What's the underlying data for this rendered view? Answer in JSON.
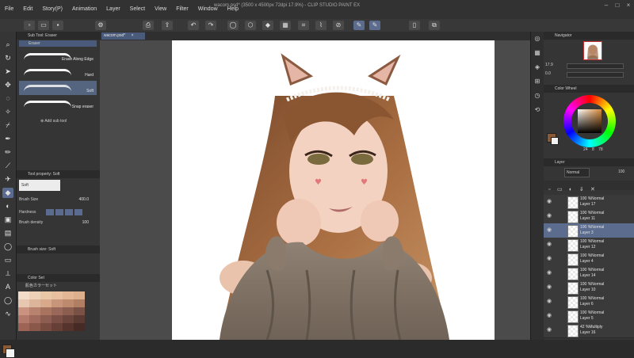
{
  "app": {
    "title": "wacom.psd* (3500 x 4500px 72dpi 17.9%) - CLIP STUDIO PAINT EX",
    "menu": [
      "File",
      "Edit",
      "Story(P)",
      "Animation",
      "Layer",
      "Select",
      "View",
      "Filter",
      "Window",
      "Help"
    ]
  },
  "document_tab": {
    "label": "wacom.psd*",
    "close": "×"
  },
  "left": {
    "subtool_header": "Sub Tool: Eraser",
    "subtool_group": "Eraser",
    "brushes": [
      {
        "label": "Erase Along Edge"
      },
      {
        "label": "Hard"
      },
      {
        "label": "Soft"
      },
      {
        "label": "Snap eraser"
      }
    ],
    "add_subtool": "Add sub tool",
    "toolprop_header": "Tool property: Soft",
    "toolprop_name": "Soft",
    "brush_size_label": "Brush Size",
    "brush_size_value": "400.0",
    "hardness_label": "Hardness",
    "density_label": "Brush density",
    "density_value": "100",
    "brushsize_header": "Brush size: Soft",
    "color_set_header": "Color Set",
    "color_set_name": "肌色カラーセット"
  },
  "right": {
    "navigator": {
      "label": "Navigator",
      "zoom": "17.9",
      "rotate": "0.0"
    },
    "color_wheel_label": "Color Wheel",
    "color_values": [
      "24",
      "8",
      "78"
    ],
    "layer_panel_label": "Layer",
    "blend_mode": "Normal",
    "opacity": "100",
    "layers": [
      {
        "mode": "100 %Normal",
        "name": "Layer 17"
      },
      {
        "mode": "100 %Normal",
        "name": "Layer 11"
      },
      {
        "mode": "100 %Normal",
        "name": "Layer 3"
      },
      {
        "mode": "100 %Normal",
        "name": "Layer 12"
      },
      {
        "mode": "100 %Normal",
        "name": "Layer 4"
      },
      {
        "mode": "100 %Normal",
        "name": "Layer 14"
      },
      {
        "mode": "100 %Normal",
        "name": "Layer 10"
      },
      {
        "mode": "100 %Normal",
        "name": "Layer 6"
      },
      {
        "mode": "100 %Normal",
        "name": "Layer 5"
      },
      {
        "mode": "42 %Multiply",
        "name": "Layer 16"
      }
    ]
  },
  "colors": {
    "main": "#8a5a36",
    "sub": "#f3f3f3",
    "accent": "#5b6c8f"
  }
}
